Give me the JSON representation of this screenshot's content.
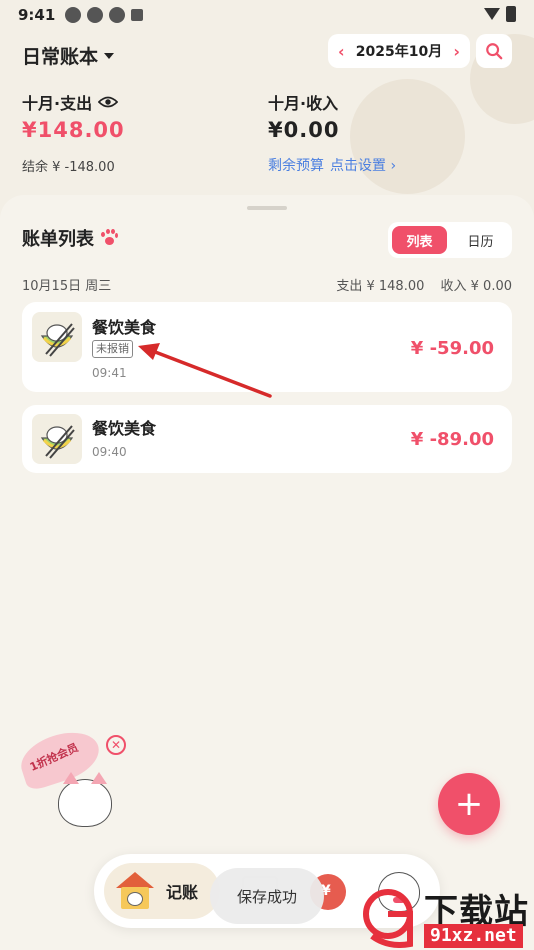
{
  "status_bar": {
    "time": "9:41"
  },
  "header": {
    "book_name": "日常账本",
    "month": "2025年10月",
    "expense_label": "十月·支出",
    "expense_amount": "¥148.00",
    "balance_text": "结余 ¥ -148.00",
    "income_label": "十月·收入",
    "income_amount": "¥0.00",
    "budget_label": "剩余预算",
    "budget_action": "点击设置 ›"
  },
  "bill_list": {
    "title": "账单列表",
    "view_options": [
      "列表",
      "日历"
    ],
    "selected_view": "列表",
    "date_label": "10月15日 周三",
    "day_expense": "支出 ¥ 148.00",
    "day_income": "收入 ¥ 0.00",
    "entries": [
      {
        "category": "餐饮美食",
        "tag": "未报销",
        "time": "09:41",
        "amount": "¥ -59.00"
      },
      {
        "category": "餐饮美食",
        "time": "09:40",
        "amount": "¥ -89.00"
      }
    ]
  },
  "promo": {
    "text": "1折抢会员"
  },
  "fab": {
    "label": "+"
  },
  "bottom_nav": {
    "home_label": "记账"
  },
  "toast": "保存成功",
  "watermark": {
    "text_main": "下载站",
    "text_url": "91xz.net"
  },
  "colors": {
    "accent": "#f0506a",
    "link": "#4b7fe0",
    "background": "#f3efe6"
  }
}
